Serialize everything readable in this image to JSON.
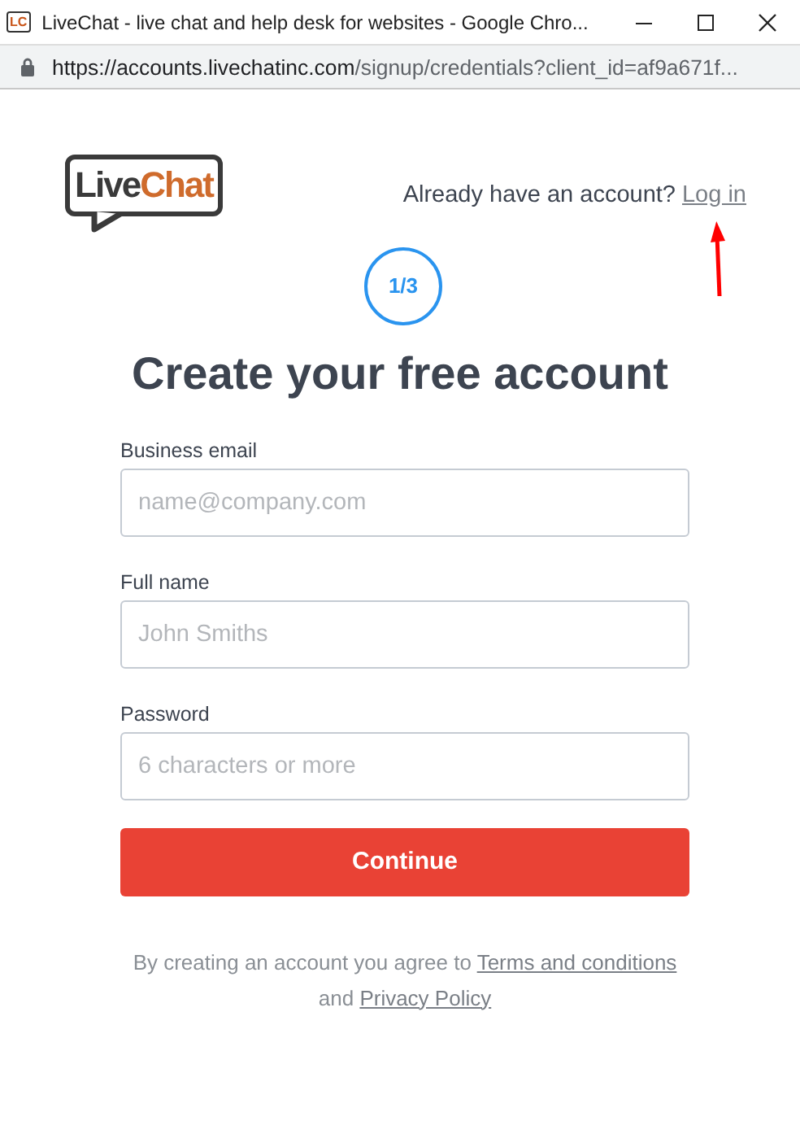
{
  "window": {
    "favicon": "LC",
    "title": "LiveChat - live chat and help desk for websites - Google Chro..."
  },
  "address_bar": {
    "host": "https://accounts.livechatinc.com",
    "path": "/signup/credentials?client_id=af9a671f..."
  },
  "logo": {
    "first": "Live",
    "second": "Chat"
  },
  "login_prompt": {
    "text": "Already have an account?",
    "link": "Log in"
  },
  "step": "1/3",
  "heading": "Create your free account",
  "fields": [
    {
      "label": "Business email",
      "placeholder": "name@company.com"
    },
    {
      "label": "Full name",
      "placeholder": "John Smiths"
    },
    {
      "label": "Password",
      "placeholder": "6 characters or more"
    }
  ],
  "submit": "Continue",
  "agreement": {
    "before": "By creating an account you agree to",
    "terms": "Terms and conditions",
    "middle": "and",
    "privacy": "Privacy Policy"
  }
}
